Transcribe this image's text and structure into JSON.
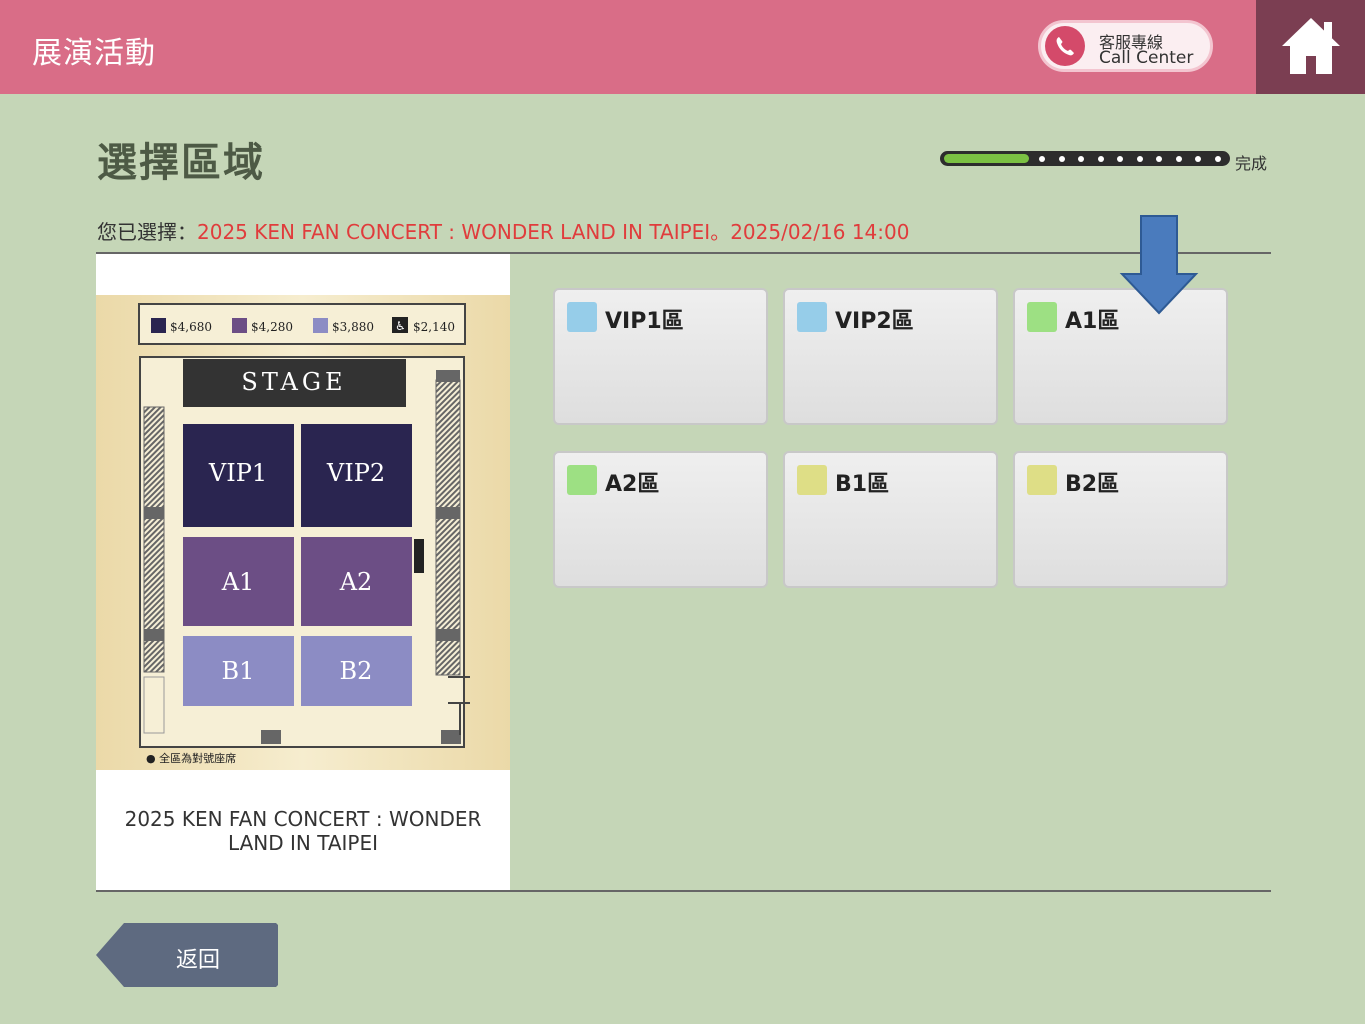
{
  "header": {
    "title": "展演活動",
    "call_center_cn": "客服專線",
    "call_center_en": "Call Center"
  },
  "page_title": "選擇區域",
  "progress": {
    "label": "完成",
    "fraction": 0.3
  },
  "selection": {
    "prefix": "您已選擇：",
    "event": "2025 KEN FAN CONCERT : WONDER LAND IN TAIPEI。2025/02/16 14:00"
  },
  "seatmap": {
    "legend": [
      "$4,680",
      "$4,280",
      "$3,880",
      "$2,140"
    ],
    "stage": "STAGE",
    "blocks": [
      "VIP1",
      "VIP2",
      "A1",
      "A2",
      "B1",
      "B2"
    ],
    "footnote": "● 全區為對號座席",
    "colors": {
      "vip": "#2a2550",
      "a": "#6c4e85",
      "b": "#8c8cc4"
    }
  },
  "poster_caption": "2025 KEN FAN CONCERT : WONDER LAND IN TAIPEI",
  "zones": [
    {
      "label": "VIP1區",
      "color": "#96cde9"
    },
    {
      "label": "VIP2區",
      "color": "#96cde9"
    },
    {
      "label": "A1區",
      "color": "#9de083"
    },
    {
      "label": "A2區",
      "color": "#9de083"
    },
    {
      "label": "B1區",
      "color": "#dede86"
    },
    {
      "label": "B2區",
      "color": "#dede86"
    }
  ],
  "back_label": "返回"
}
